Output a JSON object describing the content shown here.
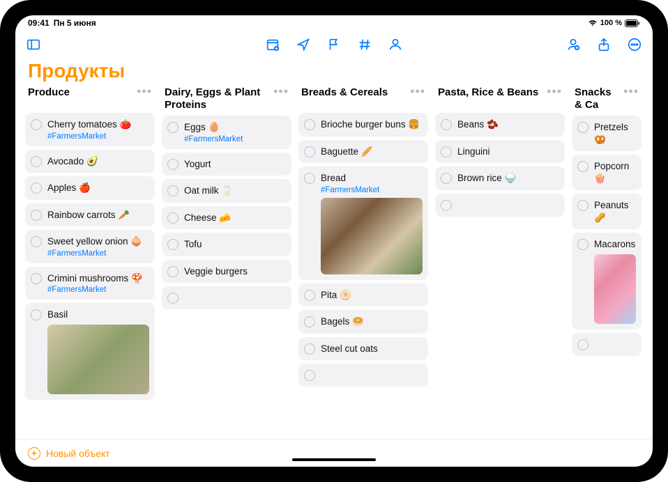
{
  "status": {
    "time": "09:41",
    "date": "Пн 5 июня",
    "battery": "100 %"
  },
  "accent": "#FF9500",
  "blue": "#007AFF",
  "title": "Продукты",
  "addNew": "Новый объект",
  "columns": [
    {
      "title": "Produce",
      "items": [
        {
          "label": "Cherry tomatoes 🍅",
          "tag": "#FarmersMarket"
        },
        {
          "label": "Avocado 🥑"
        },
        {
          "label": "Apples 🍎"
        },
        {
          "label": "Rainbow carrots 🥕"
        },
        {
          "label": "Sweet yellow onion 🧅",
          "tag": "#FarmersMarket"
        },
        {
          "label": "Crimini mushrooms 🍄",
          "tag": "#FarmersMarket"
        },
        {
          "label": "Basil",
          "image": "basil"
        }
      ]
    },
    {
      "title": "Dairy, Eggs & Plant Proteins",
      "items": [
        {
          "label": "Eggs 🥚",
          "tag": "#FarmersMarket"
        },
        {
          "label": "Yogurt"
        },
        {
          "label": "Oat milk 🥛"
        },
        {
          "label": "Cheese 🧀"
        },
        {
          "label": "Tofu"
        },
        {
          "label": "Veggie burgers"
        },
        {
          "empty": true
        }
      ]
    },
    {
      "title": "Breads & Cereals",
      "items": [
        {
          "label": "Brioche burger buns 🍔"
        },
        {
          "label": "Baguette 🥖"
        },
        {
          "label": "Bread",
          "tag": "#FarmersMarket",
          "image": "bread"
        },
        {
          "label": "Pita 🫓"
        },
        {
          "label": "Bagels 🥯"
        },
        {
          "label": "Steel cut oats"
        },
        {
          "empty": true
        }
      ]
    },
    {
      "title": "Pasta, Rice & Beans",
      "items": [
        {
          "label": "Beans 🫘"
        },
        {
          "label": "Linguini"
        },
        {
          "label": "Brown rice 🍚"
        },
        {
          "empty": true
        }
      ]
    },
    {
      "title": "Snacks & Ca",
      "items": [
        {
          "label": "Pretzels 🥨"
        },
        {
          "label": "Popcorn 🍿"
        },
        {
          "label": "Peanuts 🥜"
        },
        {
          "label": "Macarons",
          "image": "macaron"
        },
        {
          "empty": true
        }
      ]
    }
  ]
}
